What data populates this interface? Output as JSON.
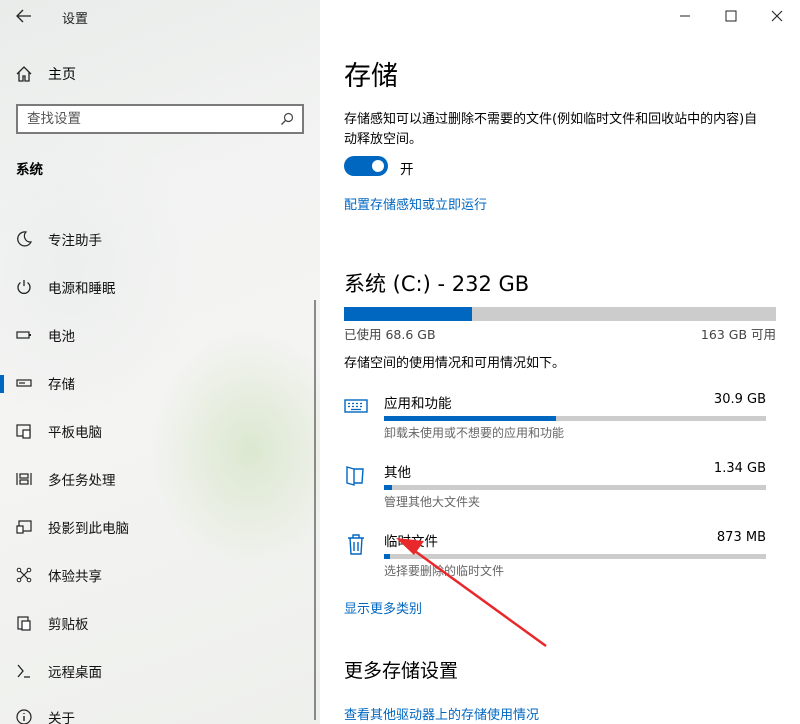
{
  "window": {
    "title": "设置"
  },
  "sidebar": {
    "home_label": "主页",
    "search_placeholder": "查找设置",
    "section_title": "系统",
    "items": [
      {
        "label": "专注助手",
        "icon": "moon-icon"
      },
      {
        "label": "电源和睡眠",
        "icon": "power-icon"
      },
      {
        "label": "电池",
        "icon": "battery-icon"
      },
      {
        "label": "存储",
        "icon": "storage-icon",
        "active": true
      },
      {
        "label": "平板电脑",
        "icon": "tablet-icon"
      },
      {
        "label": "多任务处理",
        "icon": "multitask-icon"
      },
      {
        "label": "投影到此电脑",
        "icon": "project-icon"
      },
      {
        "label": "体验共享",
        "icon": "share-icon"
      },
      {
        "label": "剪贴板",
        "icon": "clipboard-icon"
      },
      {
        "label": "远程桌面",
        "icon": "remote-desktop-icon"
      },
      {
        "label": "关于",
        "icon": "info-icon"
      }
    ]
  },
  "main": {
    "title": "存储",
    "description": "存储感知可以通过删除不需要的文件(例如临时文件和回收站中的内容)自动释放空间。",
    "toggle": {
      "state_label": "开",
      "on": true
    },
    "configure_link": "配置存储感知或立即运行",
    "drive": {
      "title": "系统 (C:) - 232 GB",
      "used_label": "已使用 68.6 GB",
      "free_label": "163 GB 可用",
      "used_fraction": 0.296
    },
    "usage_description": "存储空间的使用情况和可用情况如下。",
    "categories": [
      {
        "name": "应用和功能",
        "size": "30.9 GB",
        "subtitle": "卸载未使用或不想要的应用和功能",
        "fraction": 0.45,
        "icon": "keyboard-icon"
      },
      {
        "name": "其他",
        "size": "1.34 GB",
        "subtitle": "管理其他大文件夹",
        "fraction": 0.02,
        "icon": "folder-icon"
      },
      {
        "name": "临时文件",
        "size": "873 MB",
        "subtitle": "选择要删除的临时文件",
        "fraction": 0.015,
        "icon": "trash-icon"
      }
    ],
    "show_more_link": "显示更多类别",
    "more_settings_title": "更多存储设置",
    "other_drives_link": "查看其他驱动器上的存储使用情况"
  },
  "colors": {
    "accent": "#0067c0",
    "annotation": "#e8282b"
  }
}
